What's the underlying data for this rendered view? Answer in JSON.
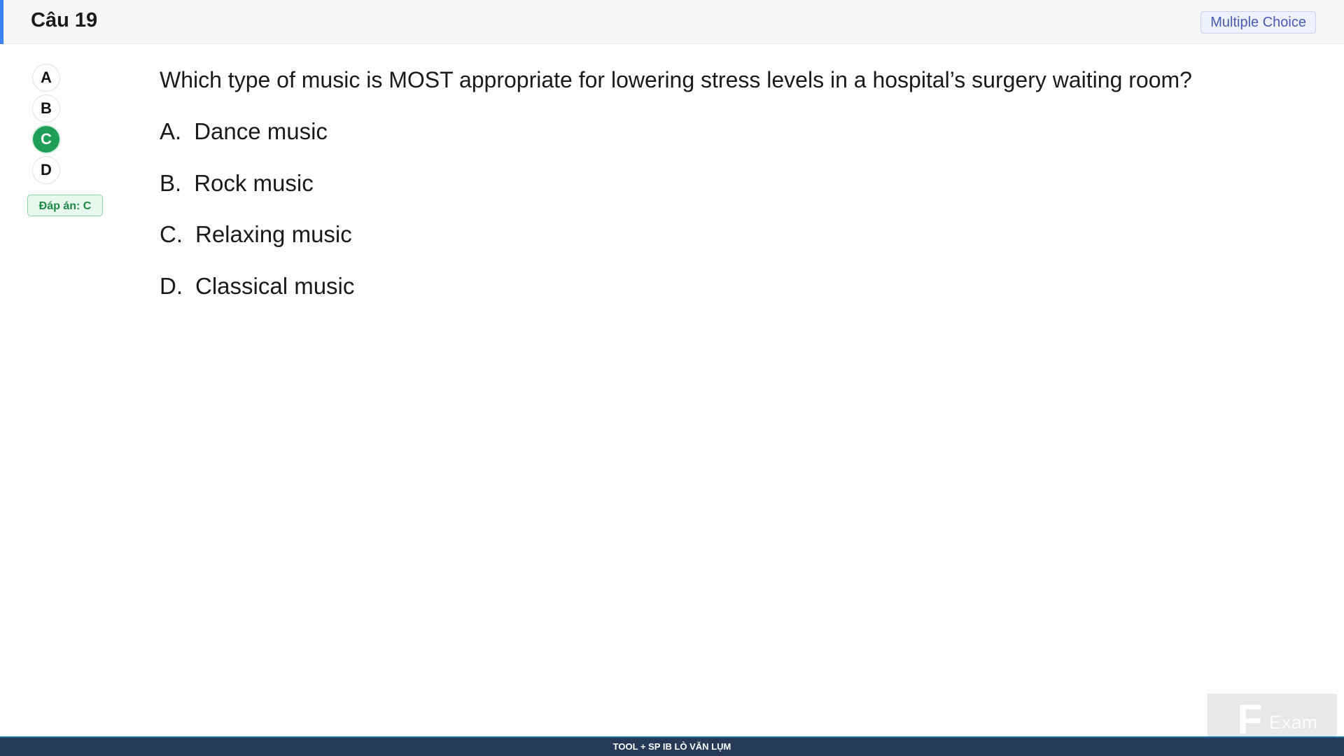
{
  "header": {
    "question_number": "Câu 19",
    "question_type": "Multiple Choice"
  },
  "selector": {
    "options": [
      "A",
      "B",
      "C",
      "D"
    ],
    "selected": "C",
    "answer_label": "Đáp án: C"
  },
  "question": {
    "text": "Which type of music is MOST appropriate for lowering stress levels in a hospital’s surgery waiting room?",
    "choices": [
      {
        "letter": "A.",
        "text": "Dance music"
      },
      {
        "letter": "B.",
        "text": "Rock music"
      },
      {
        "letter": "C.",
        "text": "Relaxing music"
      },
      {
        "letter": "D.",
        "text": "Classical music"
      }
    ]
  },
  "watermark": {
    "text": "Exam"
  },
  "footer": {
    "text": "TOOL + SP IB LÒ VĂN LỤM"
  },
  "colors": {
    "accent": "#3b82f6",
    "selected": "#1e9e56",
    "footer_bg": "#263a57"
  }
}
